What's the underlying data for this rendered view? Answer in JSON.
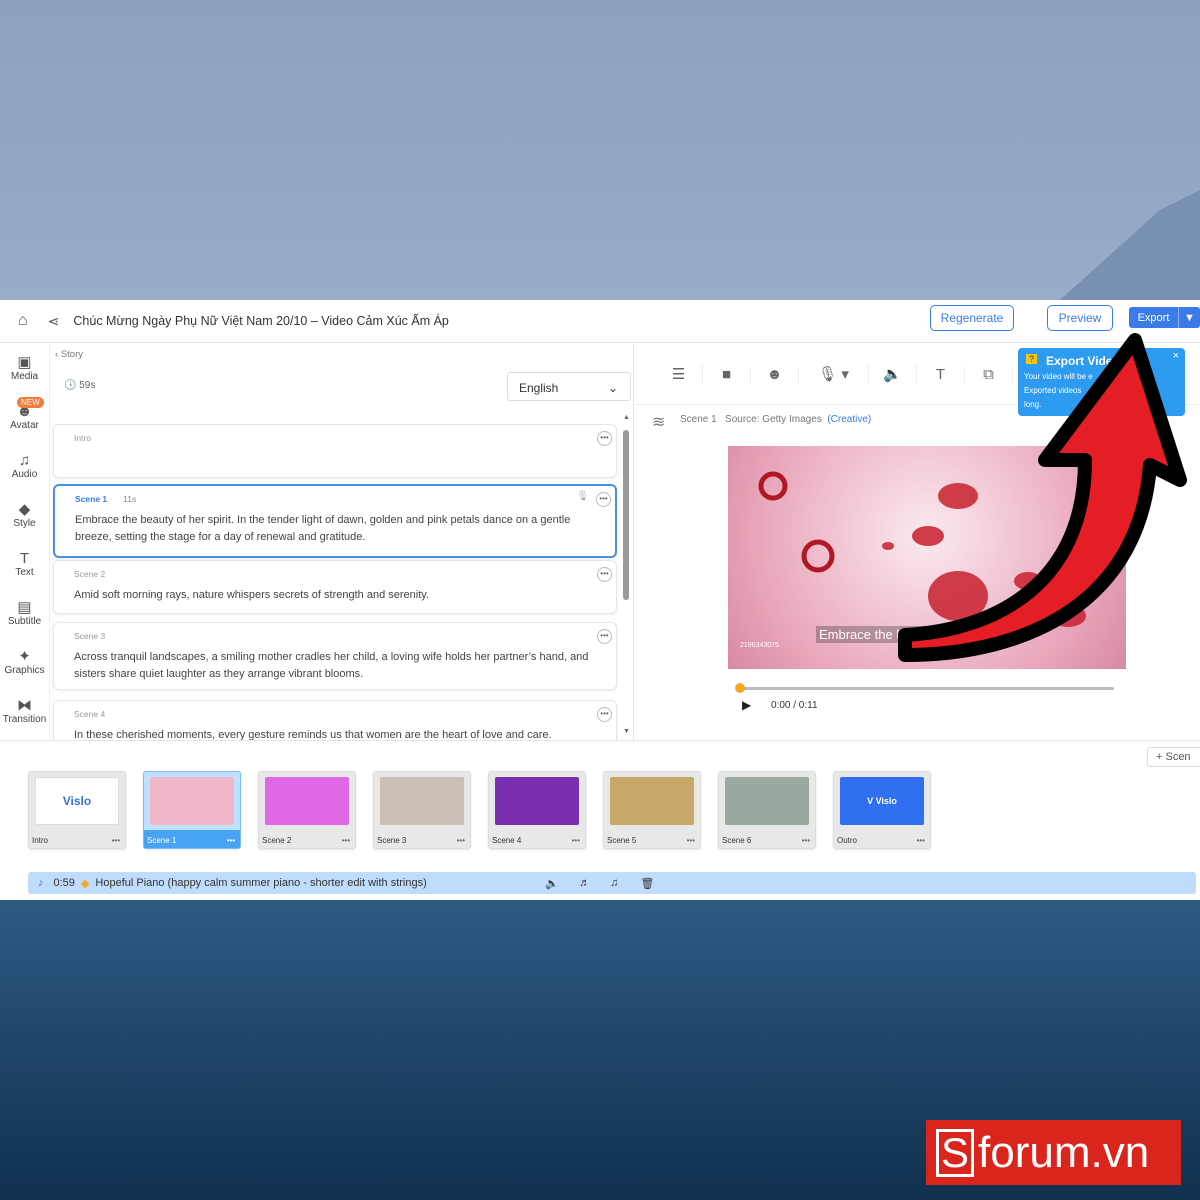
{
  "header": {
    "title": "Chúc Mừng Ngày Phụ Nữ Việt Nam 20/10 – Video Cảm Xúc Ấm Áp",
    "regenerate": "Regenerate",
    "preview": "Preview",
    "export": "Export"
  },
  "sidebar": {
    "badge": "NEW",
    "items": [
      {
        "label": "Media",
        "icon": "▣"
      },
      {
        "label": "Avatar",
        "icon": "☻"
      },
      {
        "label": "Audio",
        "icon": "♫"
      },
      {
        "label": "Style",
        "icon": "◆"
      },
      {
        "label": "Text",
        "icon": "T"
      },
      {
        "label": "Subtitle",
        "icon": "▤"
      },
      {
        "label": "Graphics",
        "icon": "✦"
      },
      {
        "label": "Transition",
        "icon": "⧓"
      }
    ]
  },
  "story": {
    "back": "Story",
    "duration": "59s",
    "language": "English",
    "cards": [
      {
        "label": "Intro",
        "text": ""
      },
      {
        "label": "Scene 1",
        "dur": "11s",
        "text": "Embrace the beauty of her spirit. In the tender light of dawn, golden and pink petals dance on a gentle breeze, setting the stage for a day of renewal and gratitude."
      },
      {
        "label": "Scene 2",
        "text": "Amid soft morning rays, nature whispers secrets of strength and serenity."
      },
      {
        "label": "Scene 3",
        "text": "Across tranquil landscapes, a smiling mother cradles her child, a loving wife holds her partner’s hand, and sisters share quiet laughter as they arrange vibrant blooms."
      },
      {
        "label": "Scene 4",
        "text": "In these cherished moments, every gesture reminds us that women are the heart of love and care."
      }
    ]
  },
  "preview": {
    "scene": "Scene 1",
    "source": "Source: Getty Images",
    "creative": "(Creative)",
    "caption": "Embrace the beauty of her",
    "image_id": "2196343075",
    "time": "0:00 / 0:11",
    "progress": 0
  },
  "tooltip": {
    "title": "Export Video",
    "line1": "Your video will be e",
    "line2": "Exported videos",
    "line3": "long.",
    "close": "×"
  },
  "timeline": {
    "add_scene": "+ Scen",
    "thumbs": [
      {
        "label": "Intro",
        "img": "Vislo",
        "color": "#ffffff"
      },
      {
        "label": "Scene 1",
        "color": "#f0b7c8"
      },
      {
        "label": "Scene 2",
        "color": "#e067e6"
      },
      {
        "label": "Scene 3",
        "color": "#c9bfb5"
      },
      {
        "label": "Scene 4",
        "color": "#7a2eb0"
      },
      {
        "label": "Scene 5",
        "color": "#c8a86a"
      },
      {
        "label": "Scene 6",
        "color": "#9aa9a0"
      },
      {
        "label": "Outro",
        "img": "V Vislo",
        "color": "#2f6ff0"
      }
    ],
    "music": {
      "time": "0:59",
      "title": "Hopeful Piano (happy calm summer piano - shorter edit with strings)"
    }
  },
  "watermark": "forum.vn"
}
